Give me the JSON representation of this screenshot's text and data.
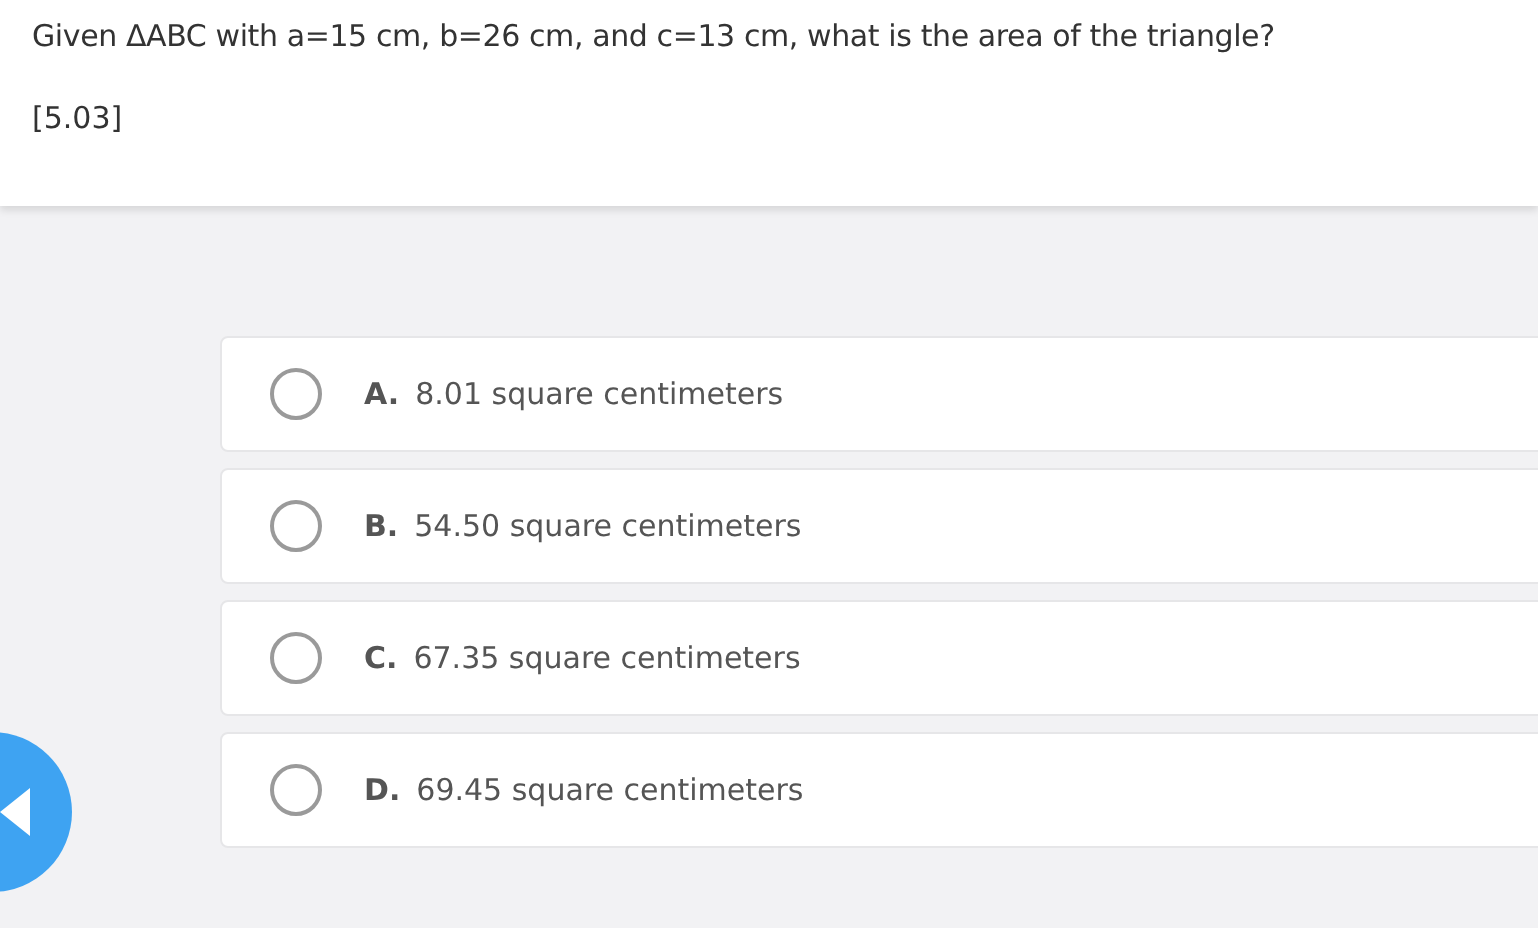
{
  "question": {
    "text": "Given ΔABC with a=15 cm, b=26 cm, and c=13 cm, what is the area of the triangle?",
    "code": "[5.03]"
  },
  "options": [
    {
      "letter": "A.",
      "text": "8.01 square centimeters",
      "selected": false
    },
    {
      "letter": "B.",
      "text": "54.50 square centimeters",
      "selected": false
    },
    {
      "letter": "C.",
      "text": "67.35 square centimeters",
      "selected": false
    },
    {
      "letter": "D.",
      "text": "69.45 square centimeters",
      "selected": false
    }
  ]
}
